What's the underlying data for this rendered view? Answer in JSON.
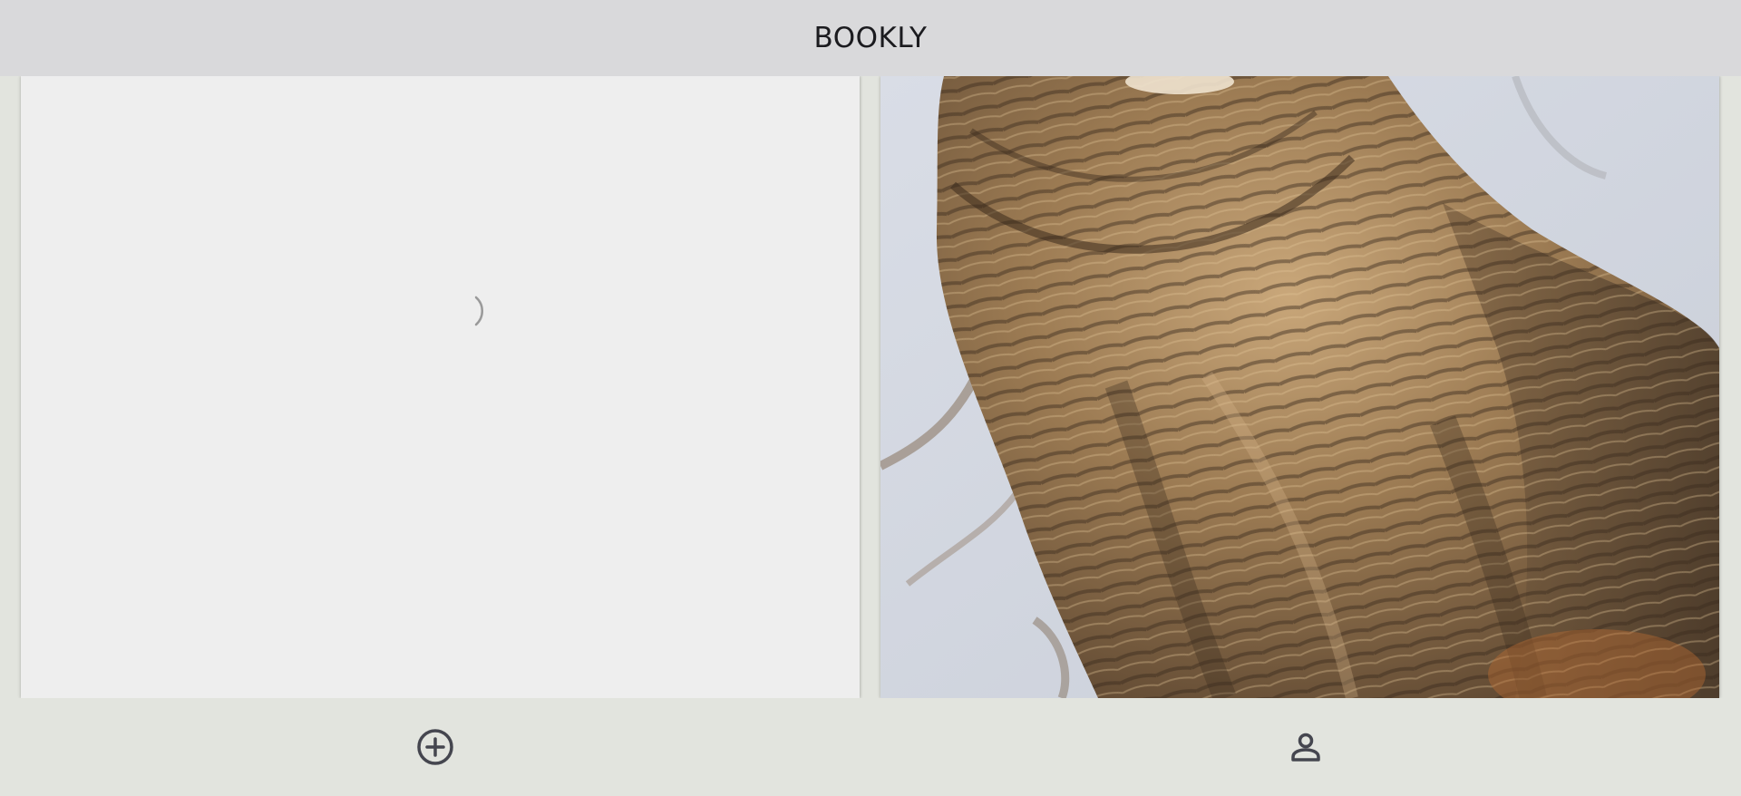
{
  "app_bar": {
    "title": "BOOKLY"
  },
  "feed": {
    "cards": [
      {
        "state": "loading",
        "indicator_icon": "spinner-icon"
      },
      {
        "state": "loaded",
        "image_subject": "tabby-cat-photo"
      }
    ]
  },
  "bottom_nav": {
    "items": [
      {
        "icon": "add-circle-icon"
      },
      {
        "icon": "person-icon"
      }
    ]
  },
  "colors": {
    "app_bar_background": "#d9d9db",
    "page_background": "#e2e4de",
    "card_background": "#eeeeee",
    "icon_color": "#45464f",
    "title_color": "#1b1b1f"
  }
}
